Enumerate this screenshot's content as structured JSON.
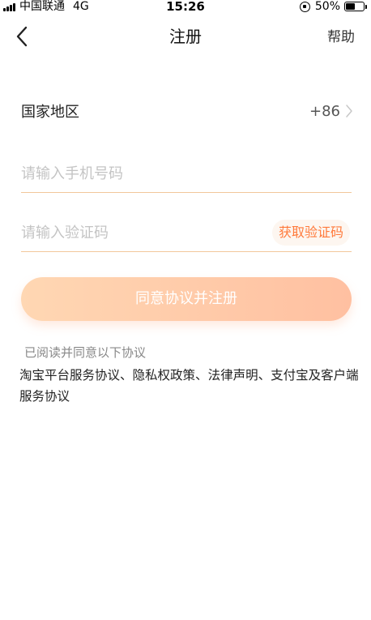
{
  "status_bar": {
    "carrier": "中国联通",
    "network": "4G",
    "time": "15:26",
    "battery_pct": "50%",
    "battery_level": 0.5
  },
  "nav": {
    "back_icon": "chevron-left-icon",
    "title": "注册",
    "help": "帮助"
  },
  "region": {
    "label": "国家地区",
    "code": "+86",
    "arrow_icon": "chevron-right-icon"
  },
  "phone": {
    "value": "",
    "placeholder": "请输入手机号码"
  },
  "code": {
    "value": "",
    "placeholder": "请输入验证码",
    "get_code": "获取验证码"
  },
  "submit": {
    "label": "同意协议并注册"
  },
  "agreement": {
    "caption": "已阅读并同意以下协议",
    "links": [
      {
        "label": "淘宝平台服务协议"
      },
      {
        "label": "隐私权政策"
      },
      {
        "label": "法律声明"
      },
      {
        "label": "支付宝及客户端服务协议"
      }
    ],
    "separator": "、"
  },
  "colors": {
    "accent": "#ff7a3b",
    "underline": "#f2c79b",
    "button_start": "#ffd7b3",
    "button_end": "#ffc0a1"
  }
}
